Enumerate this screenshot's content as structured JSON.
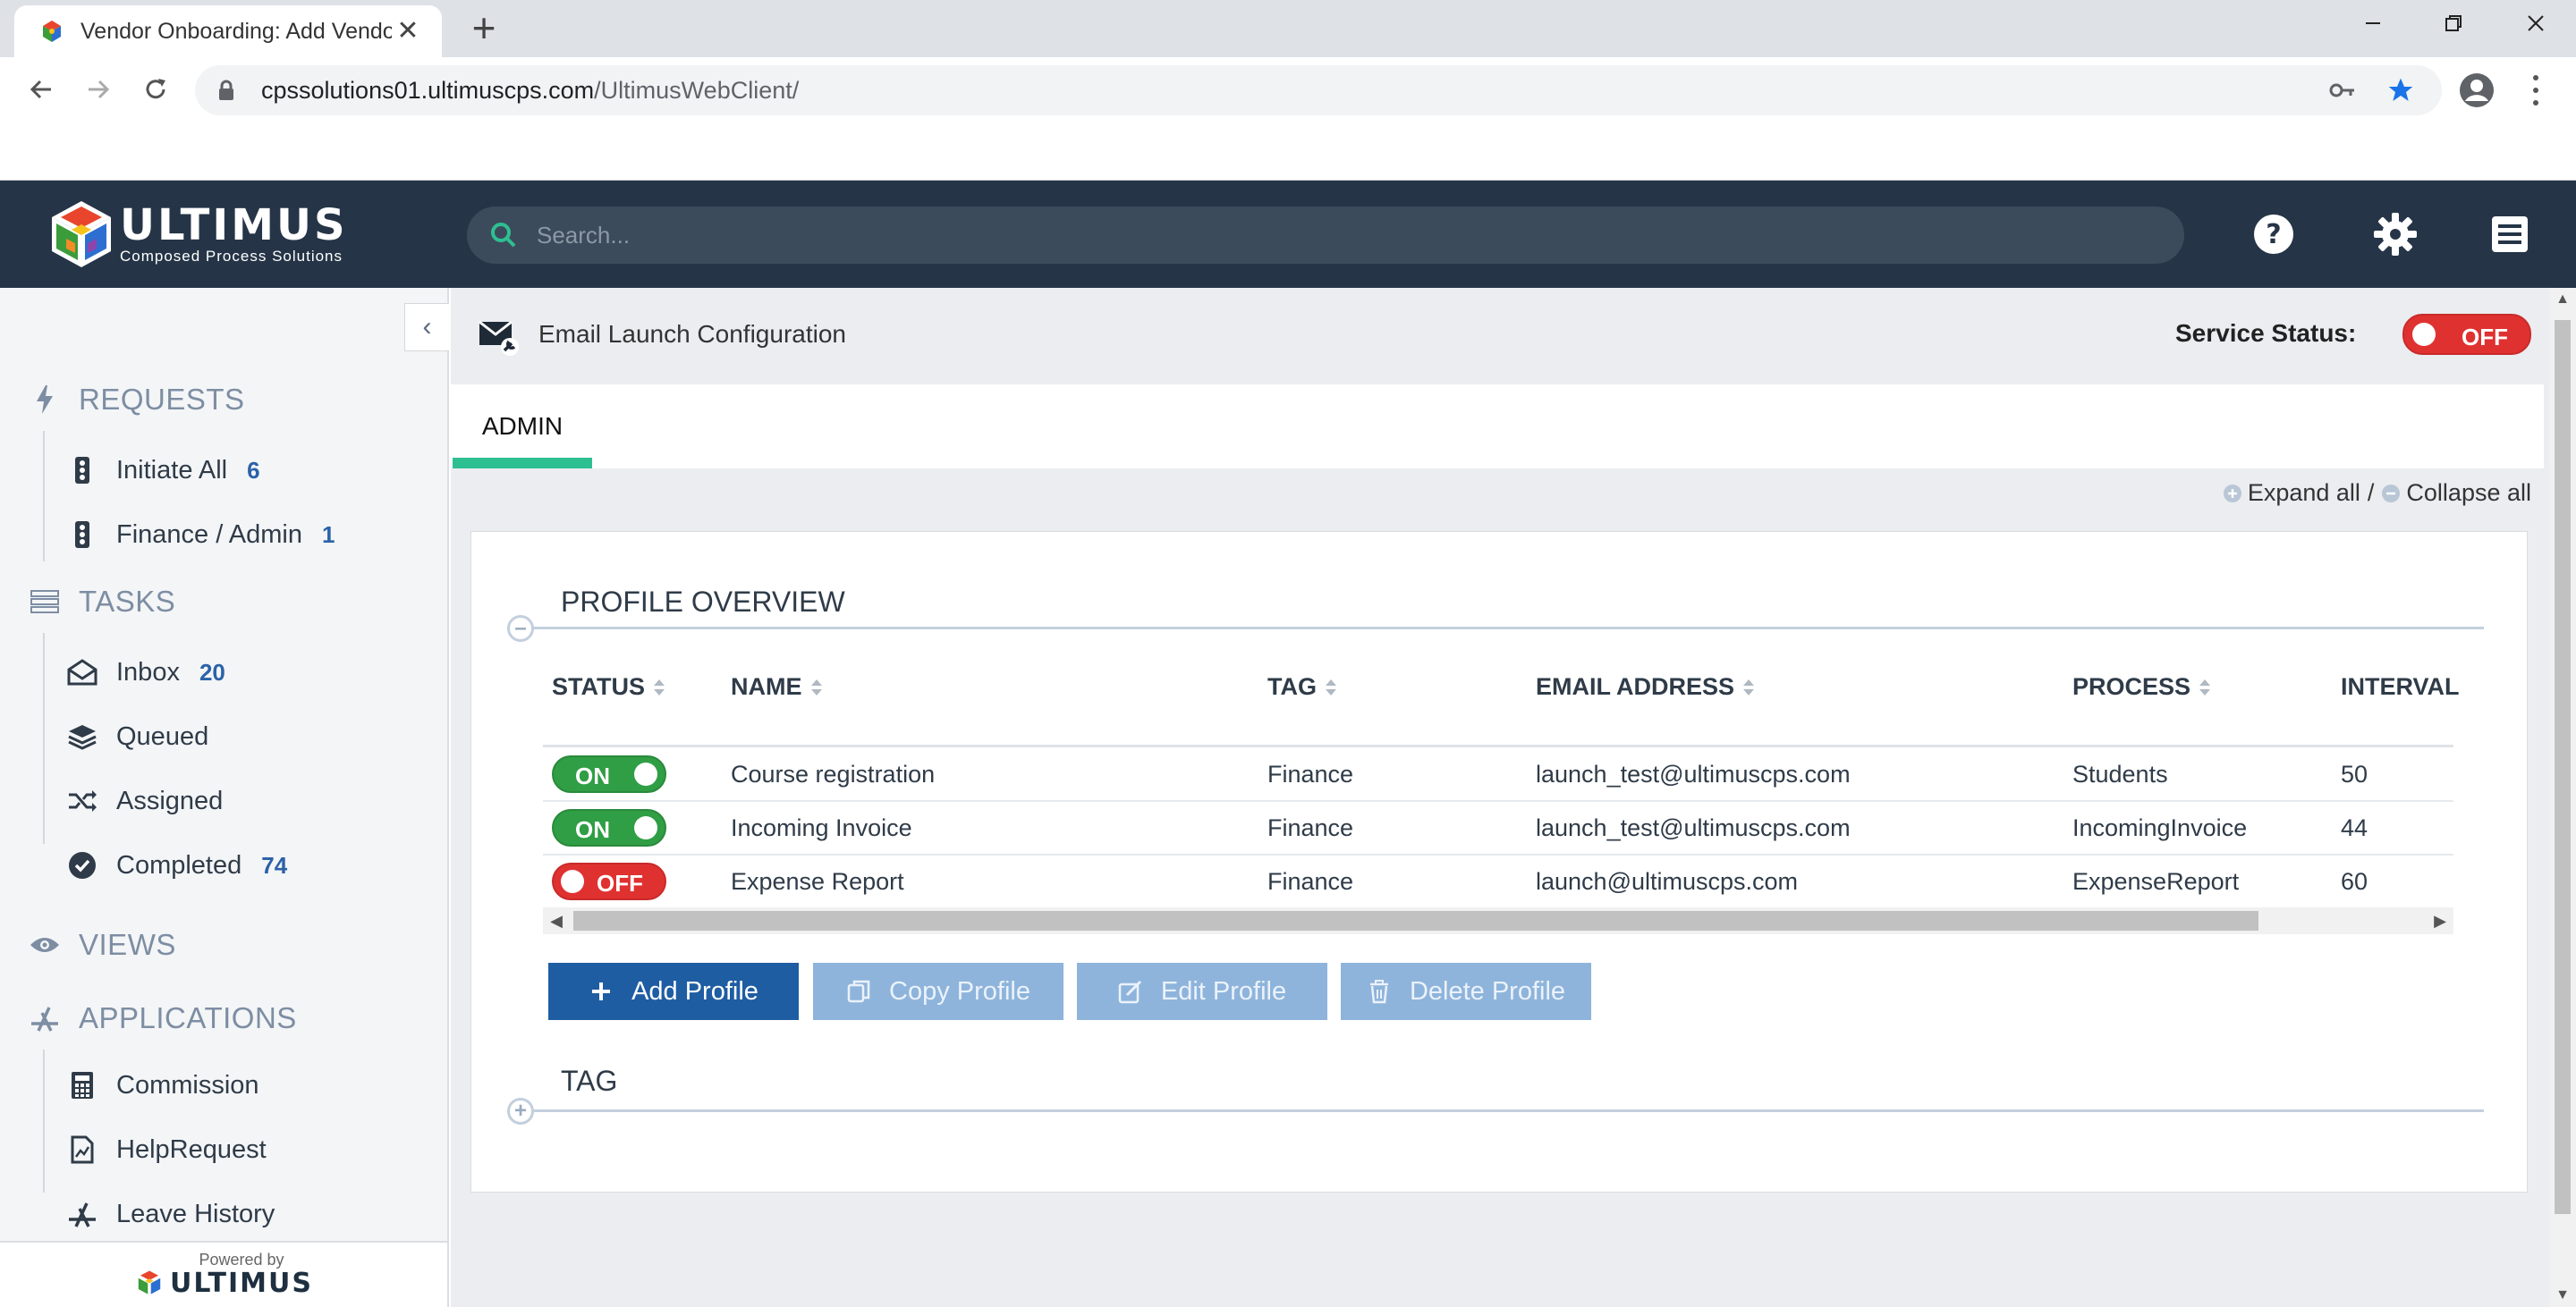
{
  "browser": {
    "tab_title": "Vendor Onboarding: Add Vendor",
    "url_host": "cpssolutions01.ultimuscps.com",
    "url_path": "/UltimusWebClient/"
  },
  "app": {
    "brand_name": "ULTIMUS",
    "brand_sub": "Composed Process Solutions",
    "search_placeholder": "Search...",
    "powered_by": "Powered by",
    "powered_brand": "ULTIMUS"
  },
  "sidebar": {
    "sections": {
      "requests": {
        "label": "REQUESTS",
        "items": [
          {
            "label": "Initiate All",
            "count": "6"
          },
          {
            "label": "Finance / Admin",
            "count": "1"
          }
        ]
      },
      "tasks": {
        "label": "TASKS",
        "items": [
          {
            "label": "Inbox",
            "count": "20"
          },
          {
            "label": "Queued",
            "count": ""
          },
          {
            "label": "Assigned",
            "count": ""
          },
          {
            "label": "Completed",
            "count": "74"
          }
        ]
      },
      "views": {
        "label": "VIEWS"
      },
      "applications": {
        "label": "APPLICATIONS",
        "items": [
          {
            "label": "Commission"
          },
          {
            "label": "HelpRequest"
          },
          {
            "label": "Leave History"
          }
        ]
      }
    }
  },
  "page": {
    "title": "Email Launch Configuration",
    "service_status_label": "Service Status:",
    "service_status_value": "OFF",
    "tab_admin": "ADMIN",
    "expand_all": "Expand all",
    "separator": "/",
    "collapse_all": "Collapse all"
  },
  "profile_overview": {
    "title": "PROFILE OVERVIEW",
    "columns": [
      "STATUS",
      "NAME",
      "TAG",
      "EMAIL ADDRESS",
      "PROCESS",
      "INTERVAL"
    ],
    "rows": [
      {
        "status": "ON",
        "name": "Course registration",
        "tag": "Finance",
        "email": "launch_test@ultimuscps.com",
        "process": "Students",
        "interval": "50"
      },
      {
        "status": "ON",
        "name": "Incoming Invoice",
        "tag": "Finance",
        "email": "launch_test@ultimuscps.com",
        "process": "IncomingInvoice",
        "interval": "44"
      },
      {
        "status": "OFF",
        "name": "Expense Report",
        "tag": "Finance",
        "email": "launch@ultimuscps.com",
        "process": "ExpenseReport",
        "interval": "60"
      }
    ],
    "buttons": {
      "add": "Add Profile",
      "copy": "Copy Profile",
      "edit": "Edit Profile",
      "delete": "Delete Profile"
    }
  },
  "tag_section": {
    "title": "TAG"
  },
  "colors": {
    "header_bg": "#253547",
    "accent_teal": "#2ebf91",
    "primary_button": "#1f5da3",
    "toggle_on": "#2f9e44",
    "toggle_off": "#e03131",
    "count_blue": "#2b62a8"
  }
}
